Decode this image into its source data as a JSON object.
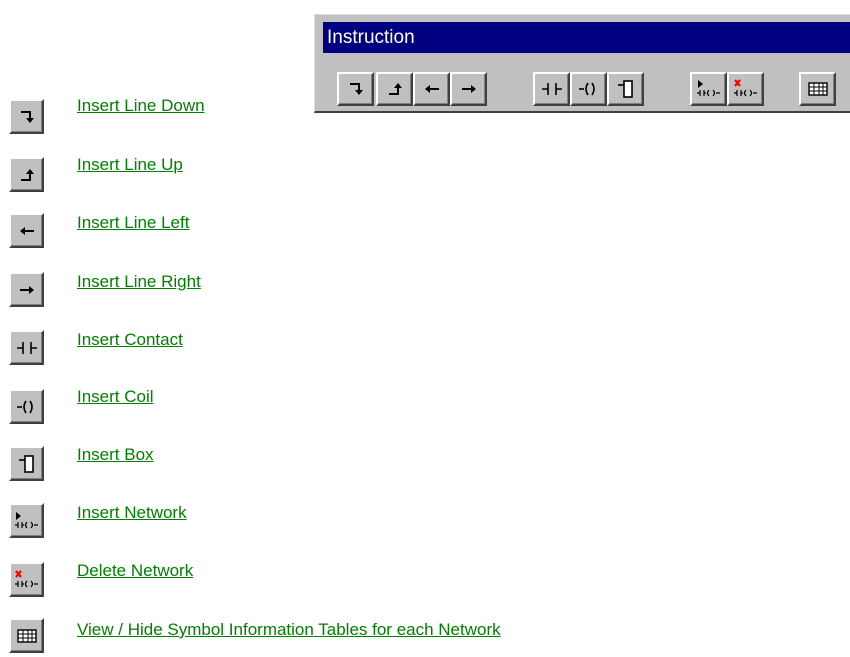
{
  "toolbar": {
    "title": "Instruction",
    "buttons": [
      {
        "icon": "line-down-icon"
      },
      {
        "icon": "line-up-icon"
      },
      {
        "icon": "line-left-icon"
      },
      {
        "icon": "line-right-icon"
      },
      {
        "icon": "contact-icon"
      },
      {
        "icon": "coil-icon"
      },
      {
        "icon": "box-icon"
      },
      {
        "icon": "insert-network-icon"
      },
      {
        "icon": "delete-network-icon"
      },
      {
        "icon": "symbol-table-icon"
      }
    ]
  },
  "legend": {
    "link_color": "#008000",
    "items": [
      {
        "label": "Insert Line Down",
        "icon": "line-down-icon"
      },
      {
        "label": "Insert Line Up",
        "icon": "line-up-icon"
      },
      {
        "label": "Insert Line Left",
        "icon": "line-left-icon"
      },
      {
        "label": "Insert Line Right",
        "icon": "line-right-icon"
      },
      {
        "label": "Insert Contact",
        "icon": "contact-icon"
      },
      {
        "label": "Insert Coil",
        "icon": "coil-icon"
      },
      {
        "label": "Insert Box",
        "icon": "box-icon"
      },
      {
        "label": "Insert Network",
        "icon": "insert-network-icon"
      },
      {
        "label": "Delete Network",
        "icon": "delete-network-icon"
      },
      {
        "label": "View / Hide Symbol Information Tables for each Network",
        "icon": "symbol-table-icon"
      }
    ]
  },
  "colors": {
    "titlebar": "#000080",
    "face": "#c0c0c0",
    "delete_mark": "#ff0000"
  }
}
